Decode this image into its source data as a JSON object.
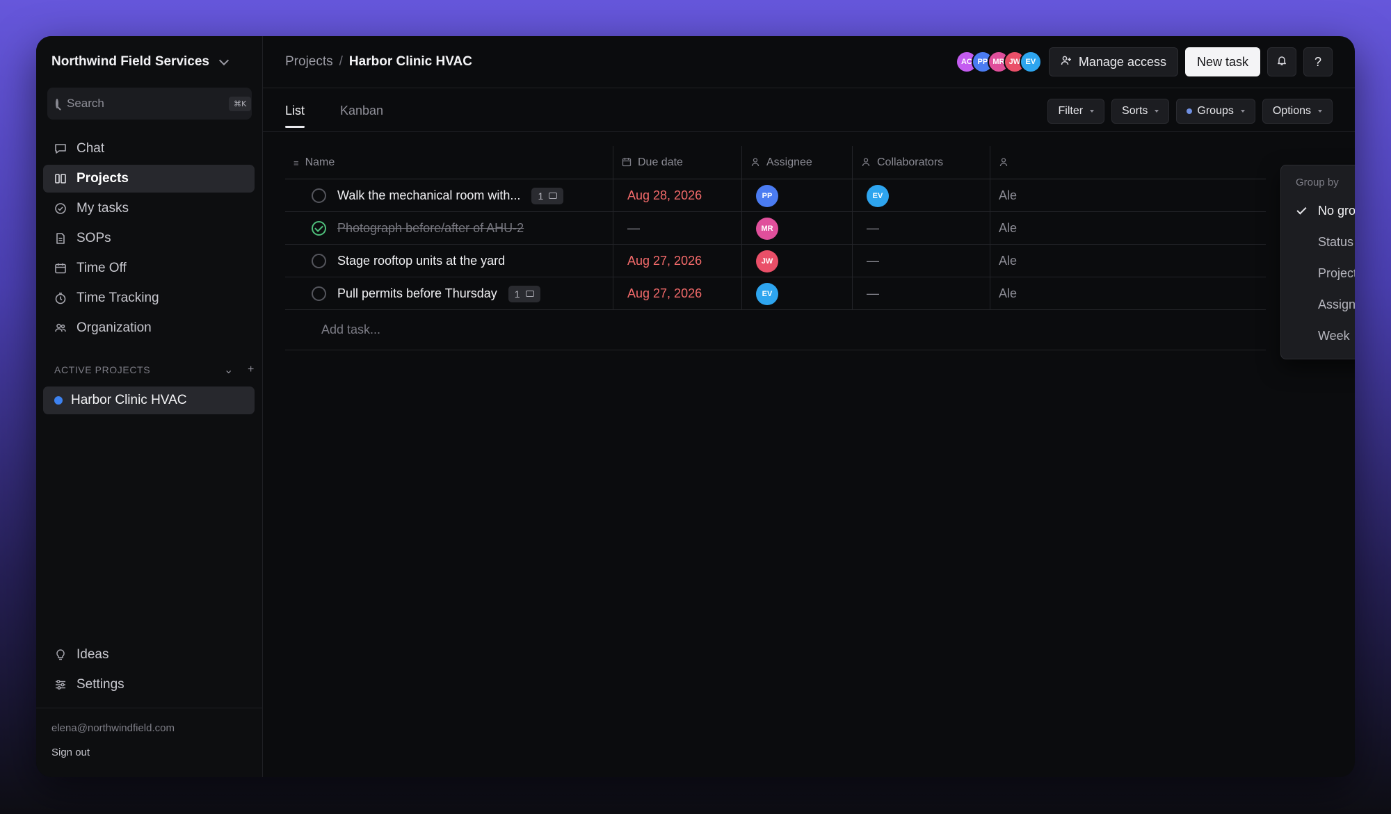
{
  "sidebar": {
    "org_name": "Northwind Field Services",
    "search_placeholder": "Search",
    "search_shortcut": "⌘K",
    "nav": [
      {
        "label": "Chat",
        "icon": "chat-icon"
      },
      {
        "label": "Projects",
        "icon": "projects-icon",
        "active": true
      },
      {
        "label": "My tasks",
        "icon": "check-circle-icon"
      },
      {
        "label": "SOPs",
        "icon": "document-icon"
      },
      {
        "label": "Time Off",
        "icon": "calendar-icon"
      },
      {
        "label": "Time Tracking",
        "icon": "timer-icon"
      },
      {
        "label": "Organization",
        "icon": "people-icon"
      }
    ],
    "section_label": "ACTIVE PROJECTS",
    "active_project": "Harbor Clinic HVAC",
    "active_project_color": "#3d82f0",
    "bottom_nav": [
      {
        "label": "Ideas",
        "icon": "lightbulb-icon"
      },
      {
        "label": "Settings",
        "icon": "sliders-icon"
      }
    ],
    "user_email": "elena@northwindfield.com",
    "sign_out_label": "Sign out"
  },
  "header": {
    "breadcrumb_parent": "Projects",
    "breadcrumb_sep": "/",
    "breadcrumb_current": "Harbor Clinic HVAC",
    "avatars": [
      {
        "initials": "AC",
        "color": "#c45cf0"
      },
      {
        "initials": "PP",
        "color": "#4b7cf2"
      },
      {
        "initials": "MR",
        "color": "#e04f9b"
      },
      {
        "initials": "JW",
        "color": "#ea4f68"
      },
      {
        "initials": "EV",
        "color": "#2ea5ef"
      }
    ],
    "manage_access_label": "Manage access",
    "new_task_label": "New task",
    "help_label": "?"
  },
  "views": {
    "tabs": [
      "List",
      "Kanban"
    ],
    "active_tab": "List",
    "toolbar": [
      "Filter",
      "Sorts",
      "Groups",
      "Options"
    ]
  },
  "table": {
    "columns": [
      "Name",
      "Due date",
      "Assignee",
      "Collaborators",
      ""
    ],
    "rows": [
      {
        "name": "Walk the mechanical room with...",
        "done": false,
        "comments": "1",
        "due": "Aug 28, 2026",
        "assignee": {
          "initials": "PP",
          "color": "#4b7cf2"
        },
        "collaborator": {
          "initials": "EV",
          "color": "#2ea5ef"
        },
        "extra": "Ale"
      },
      {
        "name": "Photograph before/after of AHU-2",
        "done": true,
        "comments": "",
        "due": "—",
        "assignee": {
          "initials": "MR",
          "color": "#e04f9b"
        },
        "collaborator": null,
        "extra": "Ale"
      },
      {
        "name": "Stage rooftop units at the yard",
        "done": false,
        "comments": "",
        "due": "Aug 27, 2026",
        "assignee": {
          "initials": "JW",
          "color": "#ea4f68"
        },
        "collaborator": null,
        "extra": "Ale"
      },
      {
        "name": "Pull permits before Thursday",
        "done": false,
        "comments": "1",
        "due": "Aug 27, 2026",
        "assignee": {
          "initials": "EV",
          "color": "#2ea5ef"
        },
        "collaborator": null,
        "extra": "Ale"
      }
    ],
    "empty_value": "—",
    "add_task_placeholder": "Add task..."
  },
  "group_menu": {
    "label": "Group by",
    "options": [
      "No grouping",
      "Status",
      "Project",
      "Assignee",
      "Week"
    ],
    "selected": "No grouping"
  }
}
